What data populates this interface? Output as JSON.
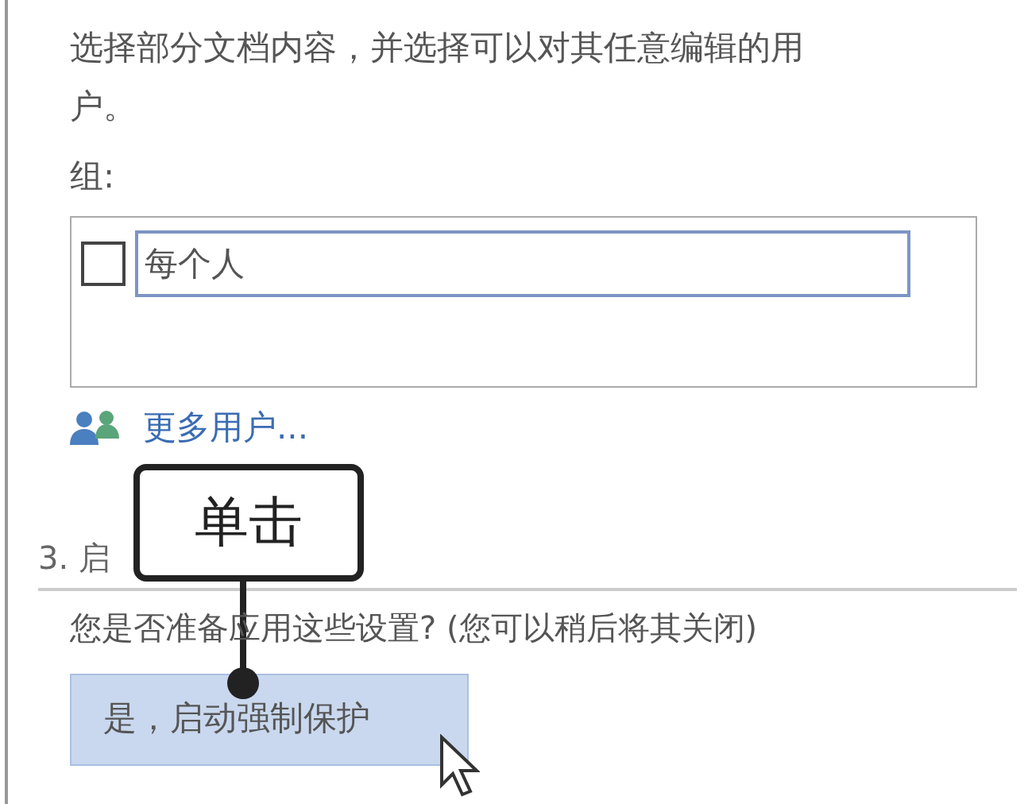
{
  "description": "选择部分文档内容，并选择可以对其任意编辑的用户。",
  "group_label": "组:",
  "groups": [
    {
      "name": "每个人",
      "checked": false
    }
  ],
  "more_users_link": "更多用户...",
  "section_heading": "3. 启",
  "question": "您是否准备应用这些设置? (您可以稍后将其关闭)",
  "start_button": "是，启动强制保护",
  "callout": "单击"
}
